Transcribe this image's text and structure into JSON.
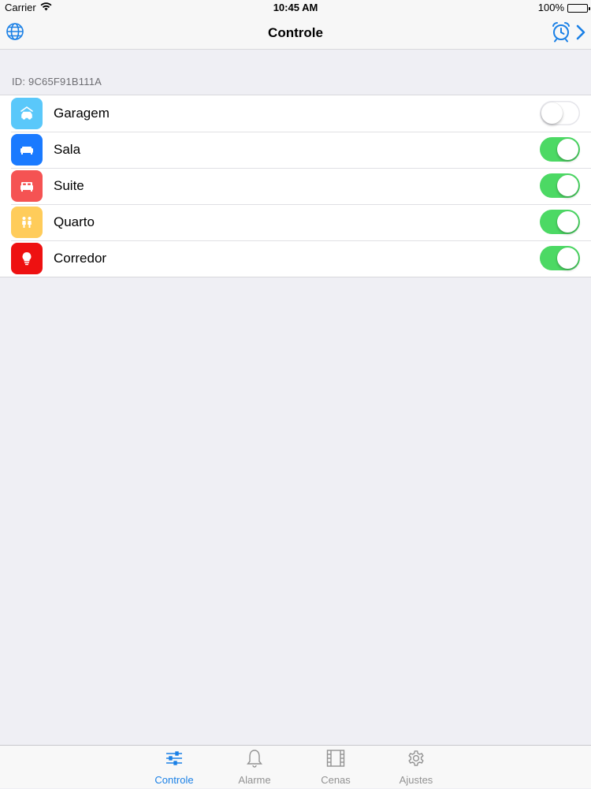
{
  "status_bar": {
    "carrier": "Carrier",
    "time": "10:45 AM",
    "battery": "100%"
  },
  "nav": {
    "title": "Controle",
    "left_icon": "globe-icon",
    "right_icons": [
      "alarm-clock-icon",
      "chevron-right-icon"
    ]
  },
  "section": {
    "header": "ID: 9C65F91B111A"
  },
  "rooms": [
    {
      "label": "Garagem",
      "icon": "car-icon",
      "color": "#5ac8fa",
      "on": false
    },
    {
      "label": "Sala",
      "icon": "sofa-icon",
      "color": "#1a7aff",
      "on": true
    },
    {
      "label": "Suite",
      "icon": "bed-icon",
      "color": "#f55353",
      "on": true
    },
    {
      "label": "Quarto",
      "icon": "kids-icon",
      "color": "#ffcc5a",
      "on": true
    },
    {
      "label": "Corredor",
      "icon": "lightbulb-icon",
      "color": "#ee1111",
      "on": true
    }
  ],
  "tabs": [
    {
      "label": "Controle",
      "icon": "sliders-icon",
      "active": true
    },
    {
      "label": "Alarme",
      "icon": "bell-icon",
      "active": false
    },
    {
      "label": "Cenas",
      "icon": "film-icon",
      "active": false
    },
    {
      "label": "Ajustes",
      "icon": "gear-icon",
      "active": false
    }
  ],
  "colors": {
    "accent": "#1a80e6",
    "switch_on": "#4cd964",
    "background": "#efeff4"
  }
}
